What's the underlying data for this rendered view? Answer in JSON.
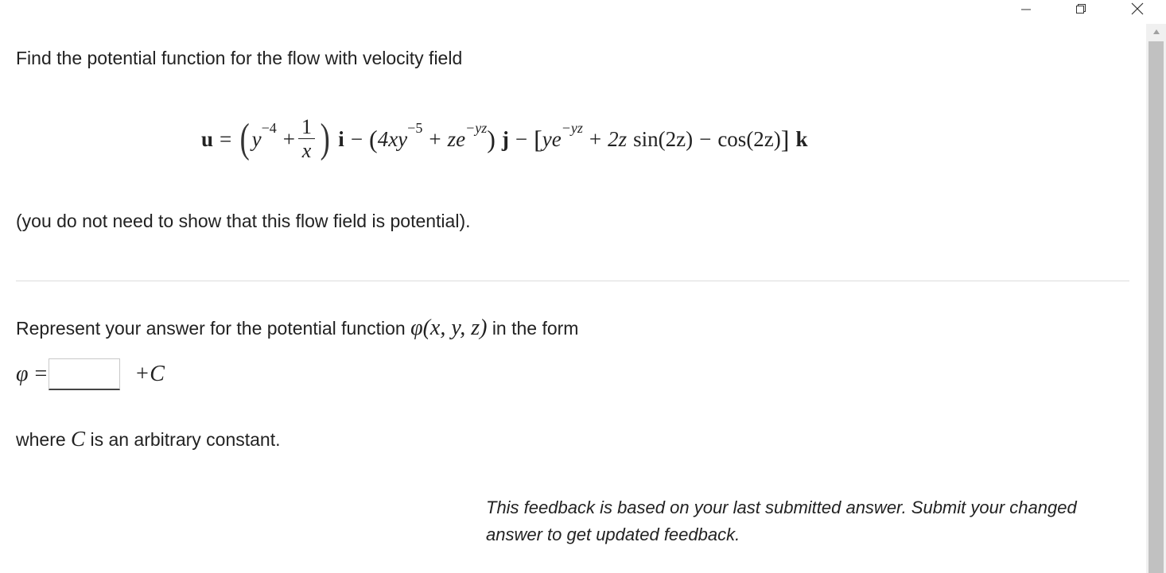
{
  "window": {
    "minimize_icon": "minimize-icon",
    "restore_icon": "restore-icon",
    "close_icon": "close-icon"
  },
  "question": {
    "intro": "Find the potential function for the flow with velocity field",
    "note": "(you do not need to show that this flow field is potential).",
    "represent_prefix": "Represent your answer for the potential function",
    "represent_suffix": "in the form",
    "where_prefix": "where",
    "where_suffix": "is an arbitrary constant."
  },
  "equation": {
    "lhs": "u",
    "t1_base": "y",
    "t1_exp": "−4",
    "t1_frac_num": "1",
    "t1_frac_den": "x",
    "unit_i": "i",
    "t2_a": "4xy",
    "t2_exp": "−5",
    "t2_b": "ze",
    "t2_b_exp": "−yz",
    "unit_j": "j",
    "t3_a": "ye",
    "t3_a_exp": "−yz",
    "t3_b": "2z",
    "t3_sin": "sin(2z)",
    "t3_cos": "cos(2z)",
    "unit_k": "k"
  },
  "answer": {
    "phi": "φ",
    "args": "(x, y, z)",
    "input_value": "",
    "plus_c": "+C",
    "c": "C"
  },
  "feedback": {
    "text": "This feedback is based on your last submitted answer. Submit your changed answer to get updated feedback."
  }
}
